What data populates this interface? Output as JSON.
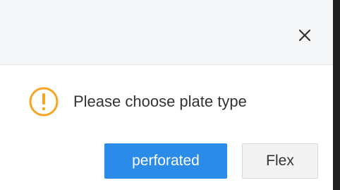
{
  "dialog": {
    "close_icon": "close-icon",
    "message_icon": "warning-circle-icon",
    "message": "Please choose plate type",
    "buttons": {
      "primary_label": "perforated",
      "secondary_label": "Flex"
    }
  },
  "colors": {
    "primary": "#2b8be8",
    "warning": "#f5a623",
    "header_bg": "#f6f7f8"
  }
}
